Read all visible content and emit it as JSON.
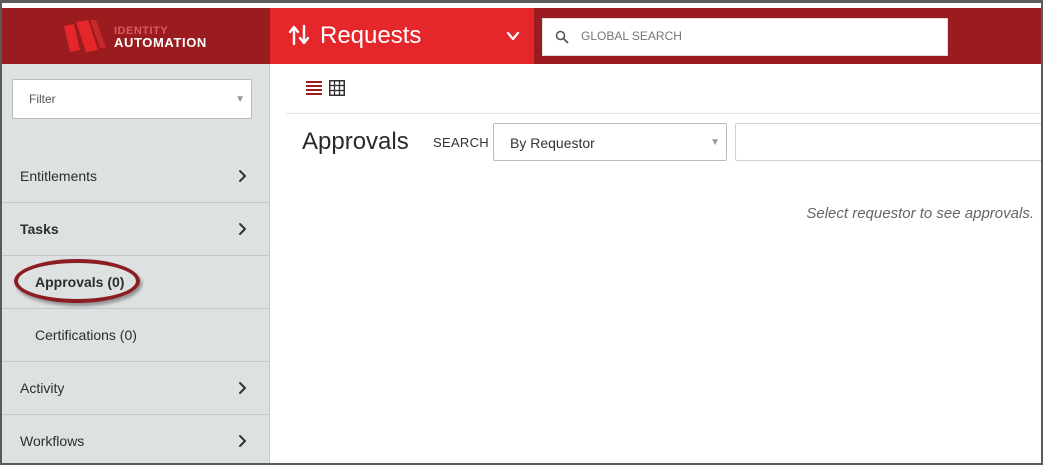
{
  "brand": {
    "line1": "IDENTITY",
    "line2": "AUTOMATION"
  },
  "header": {
    "app_title": "Requests",
    "global_search": {
      "placeholder": "GLOBAL SEARCH"
    }
  },
  "sidebar": {
    "filter": {
      "label": "Filter"
    },
    "items": [
      {
        "label": "Entitlements",
        "has_chevron": true
      },
      {
        "label": "Tasks",
        "has_chevron": true,
        "bold": true
      },
      {
        "label": "Approvals (0)",
        "sub": true,
        "bold": true,
        "active": true
      },
      {
        "label": "Certifications (0)",
        "sub": true
      },
      {
        "label": "Activity",
        "has_chevron": true
      },
      {
        "label": "Workflows",
        "has_chevron": true
      }
    ]
  },
  "main": {
    "title": "Approvals",
    "search_label": "SEARCH",
    "search_by": {
      "selected": "By Requestor"
    },
    "empty_message": "Select requestor to see approvals."
  },
  "colors": {
    "topbar": "#9b1c1f",
    "accent": "#e5262b",
    "sidebar_bg": "#dde1e2",
    "highlight_ring": "#8c1d20"
  },
  "icons": [
    "logo-icon",
    "swap-arrows-icon",
    "chevron-down-icon",
    "search-icon",
    "chevron-right-icon",
    "list-view-icon",
    "grid-view-icon"
  ]
}
